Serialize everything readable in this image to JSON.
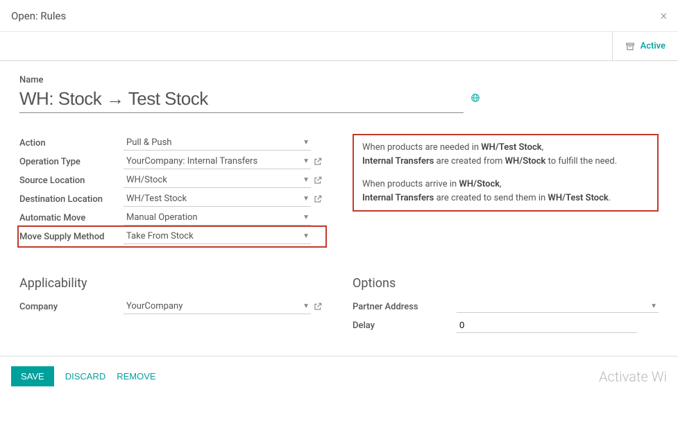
{
  "modal": {
    "title": "Open: Rules",
    "close": "×",
    "active_label": "Active"
  },
  "rule": {
    "name_label": "Name",
    "name": "WH: Stock → Test Stock"
  },
  "fields": {
    "action": {
      "label": "Action",
      "value": "Pull & Push"
    },
    "operation_type": {
      "label": "Operation Type",
      "value": "YourCompany: Internal Transfers"
    },
    "source_location": {
      "label": "Source Location",
      "value": "WH/Stock"
    },
    "destination_location": {
      "label": "Destination Location",
      "value": "WH/Test Stock"
    },
    "automatic_move": {
      "label": "Automatic Move",
      "value": "Manual Operation"
    },
    "move_supply_method": {
      "label": "Move Supply Method",
      "value": "Take From Stock"
    }
  },
  "description": {
    "line1a": "When products are needed in ",
    "line1b": "WH/Test Stock",
    "line1c": ",",
    "line2a": "Internal Transfers",
    "line2b": " are created from ",
    "line2c": "WH/Stock",
    "line2d": " to fulfill the need.",
    "line3a": "When products arrive in ",
    "line3b": "WH/Stock",
    "line3c": ",",
    "line4a": "Internal Transfers",
    "line4b": " are created to send them in ",
    "line4c": "WH/Test Stock",
    "line4d": "."
  },
  "sections": {
    "applicability": "Applicability",
    "options": "Options"
  },
  "applicability": {
    "company": {
      "label": "Company",
      "value": "YourCompany"
    }
  },
  "options": {
    "partner_address": {
      "label": "Partner Address",
      "value": ""
    },
    "delay": {
      "label": "Delay",
      "value": "0"
    }
  },
  "footer": {
    "save": "SAVE",
    "discard": "DISCARD",
    "remove": "REMOVE",
    "watermark": "Activate Wi"
  }
}
